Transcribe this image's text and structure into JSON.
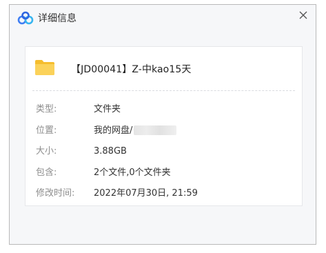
{
  "window": {
    "title": "详细信息",
    "icon": "baidu-netdisk-cloud-icon",
    "close_icon": "close-icon"
  },
  "file": {
    "icon": "folder-icon",
    "name": "【JD00041】Z-中kao15天"
  },
  "details": [
    {
      "label": "类型:",
      "value": "文件夹"
    },
    {
      "label": "位置:",
      "value": "我的网盘/",
      "blurred_suffix": true
    },
    {
      "label": "大小:",
      "value": "3.88GB"
    },
    {
      "label": "包含:",
      "value": "2个文件,0个文件夹"
    },
    {
      "label": "修改时间:",
      "value": "2022年07月30日, 21:59"
    }
  ],
  "colors": {
    "folder": "#f7c843",
    "icon_blue": "#3f7ef3",
    "label": "#8d8d8d",
    "value": "#333333"
  }
}
